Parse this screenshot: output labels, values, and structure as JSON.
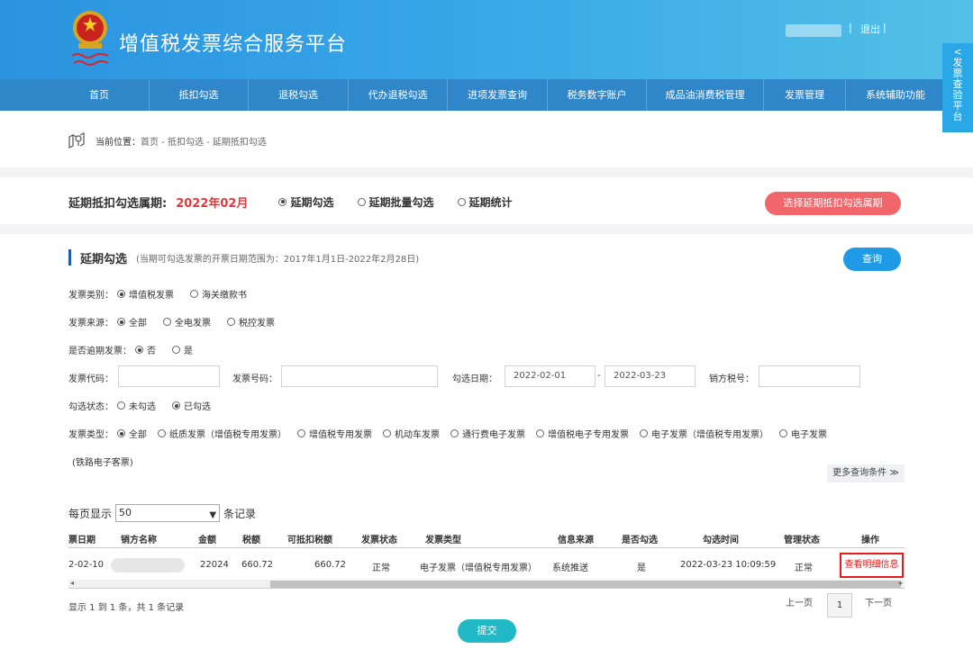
{
  "header": {
    "title": "增值税发票综合服务平台",
    "logo_icon": "national-tax-emblem-icon",
    "separator": "|",
    "logout": "退出"
  },
  "nav": {
    "items": [
      "首页",
      "抵扣勾选",
      "退税勾选",
      "代办退税勾选",
      "进项发票查询",
      "税务数字账户",
      "成品油消费税管理",
      "发票管理",
      "系统辅助功能"
    ]
  },
  "side_tab": {
    "arrow": "<",
    "label": "发票查验平台"
  },
  "breadcrumb": {
    "label": "当前位置：",
    "path": "首页 - 抵扣勾选 - 延期抵扣勾选"
  },
  "period": {
    "label": "延期抵扣勾选属期:",
    "value": "2022年02月",
    "options": [
      "延期勾选",
      "延期批量勾选",
      "延期统计"
    ],
    "selected": 0,
    "button": "选择延期抵扣勾选属期"
  },
  "section": {
    "title": "延期勾选",
    "note": "(当期可勾选发票的开票日期范围为：2017年1月1日-2022年2月28日)",
    "query_button": "查询"
  },
  "filters": {
    "invoice_category": {
      "label": "发票类别：",
      "options": [
        "增值税发票",
        "海关缴款书"
      ],
      "selected": 0
    },
    "invoice_source": {
      "label": "发票来源：",
      "options": [
        "全部",
        "全电发票",
        "税控发票"
      ],
      "selected": 0
    },
    "overdue": {
      "label": "是否逾期发票：",
      "options": [
        "否",
        "是"
      ],
      "selected": 0
    },
    "invoice_code": {
      "label": "发票代码：",
      "value": ""
    },
    "invoice_number": {
      "label": "发票号码：",
      "value": ""
    },
    "select_date": {
      "label": "勾选日期：",
      "from": "2022-02-01",
      "dash": "-",
      "to": "2022-03-23"
    },
    "seller_tax_id": {
      "label": "销方税号：",
      "value": ""
    },
    "select_status": {
      "label": "勾选状态：",
      "options": [
        "未勾选",
        "已勾选"
      ],
      "selected": 1
    },
    "invoice_type": {
      "label": "发票类型：",
      "options": [
        "全部",
        "纸质发票（增值税专用发票）",
        "增值税专用发票",
        "机动车发票",
        "通行费电子发票",
        "增值税电子专用发票",
        "电子发票（增值税专用发票）",
        "电子发票"
      ],
      "wrap_text": "(铁路电子客票)",
      "selected": 0
    },
    "more_conditions": "更多查询条件 ≫"
  },
  "table": {
    "per_page_label": "每页显示",
    "per_page_value": "50",
    "per_page_suffix": "条记录",
    "columns": [
      "票日期",
      "销方名称",
      "金额",
      "税额",
      "可抵扣税额",
      "发票状态",
      "发票类型",
      "信息来源",
      "是否勾选",
      "勾选时间",
      "管理状态",
      "操作"
    ],
    "rows": [
      {
        "date": "2-02-10",
        "seller": "",
        "amount": "22024",
        "tax": "660.72",
        "deductible": "660.72",
        "status": "正常",
        "type": "电子发票（增值税专用发票）",
        "source": "系统推送",
        "selected": "是",
        "select_time": "2022-03-23 10:09:59",
        "manage_status": "正常",
        "action": "查看明细信息"
      }
    ],
    "summary": "显示 1 到 1 条，共 1 条记录",
    "prev": "上一页",
    "page": "1",
    "next": "下一页"
  },
  "submit": "提交"
}
